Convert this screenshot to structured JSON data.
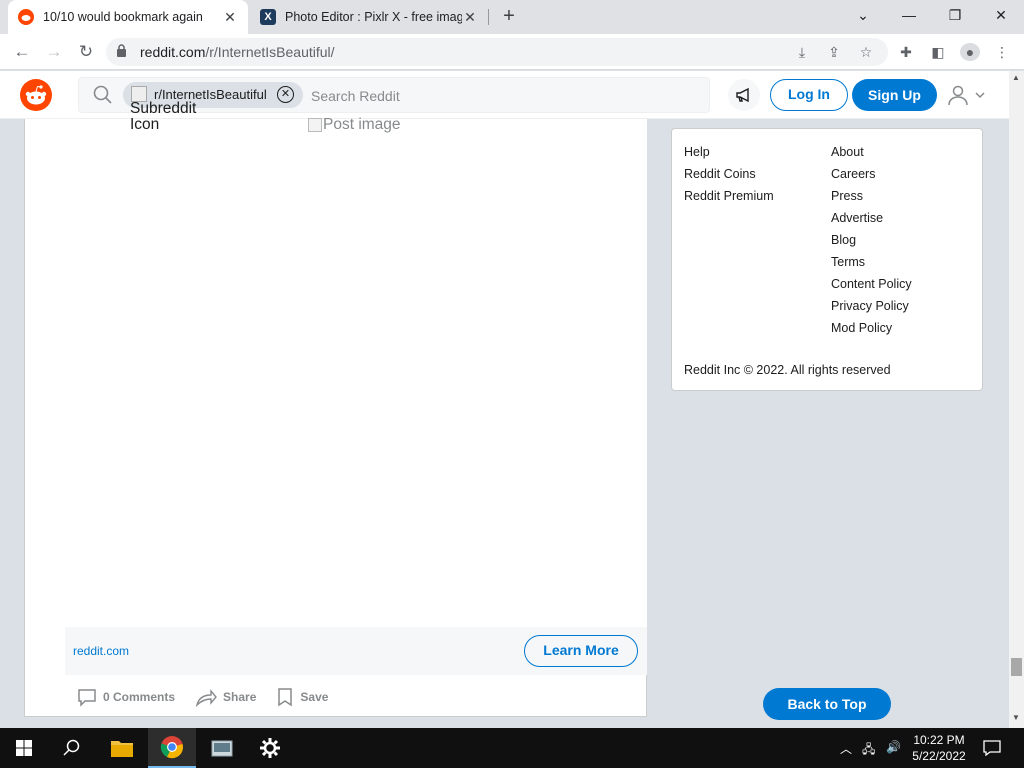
{
  "browser": {
    "tabs": [
      {
        "title": "10/10 would bookmark again",
        "active": true,
        "icon": "reddit-icon"
      },
      {
        "title": "Photo Editor : Pixlr X - free imag",
        "active": false,
        "icon": "pixlr-icon"
      }
    ],
    "url_host": "reddit.com",
    "url_path": "/r/InternetIsBeautiful/"
  },
  "header": {
    "chip_label": "r/InternetIsBeautiful",
    "search_placeholder": "Search Reddit",
    "subreddit_icon_alt": "Subreddit Icon",
    "login_label": "Log In",
    "signup_label": "Sign Up"
  },
  "post": {
    "image_alt": "Post image",
    "domain": "reddit.com",
    "learn_more": "Learn More",
    "comments_label": "0 Comments",
    "share_label": "Share",
    "save_label": "Save"
  },
  "sidebar": {
    "col1": [
      "Help",
      "Reddit Coins",
      "Reddit Premium"
    ],
    "col2": [
      "About",
      "Careers",
      "Press",
      "Advertise",
      "Blog",
      "Terms",
      "Content Policy",
      "Privacy Policy",
      "Mod Policy"
    ],
    "copyright": "Reddit Inc © 2022. All rights reserved"
  },
  "back_to_top": "Back to Top",
  "taskbar": {
    "time": "10:22 PM",
    "date": "5/22/2022"
  },
  "colors": {
    "reddit_orange": "#ff4500",
    "reddit_blue": "#0079d3"
  }
}
